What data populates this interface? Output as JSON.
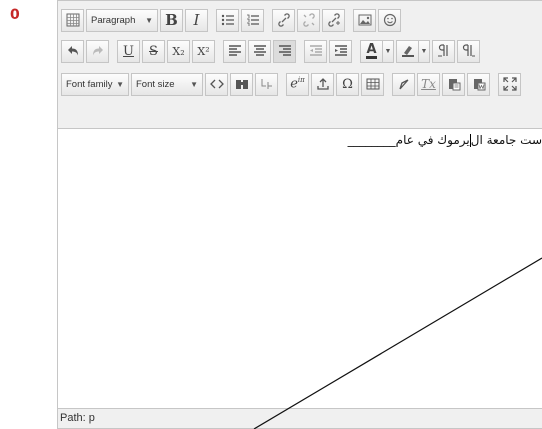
{
  "required_marker": "0",
  "toolbar": {
    "row1": {
      "toggle_icon": "toolbar-toggle-icon",
      "format_select": "Paragraph",
      "bold": "B",
      "italic": "I",
      "unordered_list_icon": "bullet-list-icon",
      "ordered_list_icon": "numbered-list-icon",
      "link_icon": "link-icon",
      "unlink_icon": "unlink-icon",
      "anchor_icon": "anchor-link-icon",
      "image_icon": "image-icon",
      "emoticon_icon": "smiley-icon"
    },
    "row2": {
      "undo_icon": "undo-icon",
      "redo_icon": "redo-icon",
      "underline": "U",
      "strikethrough": "S",
      "subscript": "X₂",
      "superscript": "X²",
      "align_left_icon": "align-left-icon",
      "align_center_icon": "align-center-icon",
      "align_right_icon": "align-right-icon",
      "outdent_icon": "outdent-icon",
      "indent_icon": "indent-icon",
      "text_color": "A",
      "background_color_icon": "highlight-color-icon",
      "ltr_icon": "ltr-icon",
      "rtl_icon": "rtl-icon"
    },
    "row3": {
      "font_family_select": "Font family",
      "font_size_select": "Font size",
      "code_icon": "code-icon",
      "search_replace_icon": "search-replace-icon",
      "nonbreaking_icon": "nonbreaking-space-icon",
      "equation_icon": "equation-icon",
      "upload_icon": "upload-icon",
      "special_char": "Ω",
      "table_icon": "table-icon",
      "clear_format_icon": "eraser-icon",
      "remove_format": "Tx",
      "paste_text_icon": "paste-text-icon",
      "paste_word_icon": "paste-word-icon",
      "fullscreen_icon": "fullscreen-icon"
    }
  },
  "content": {
    "text_before_caret": "ست جامعة ال",
    "text_after_caret": "يرموك في عام________"
  },
  "statusbar": {
    "path": "Path: p"
  }
}
